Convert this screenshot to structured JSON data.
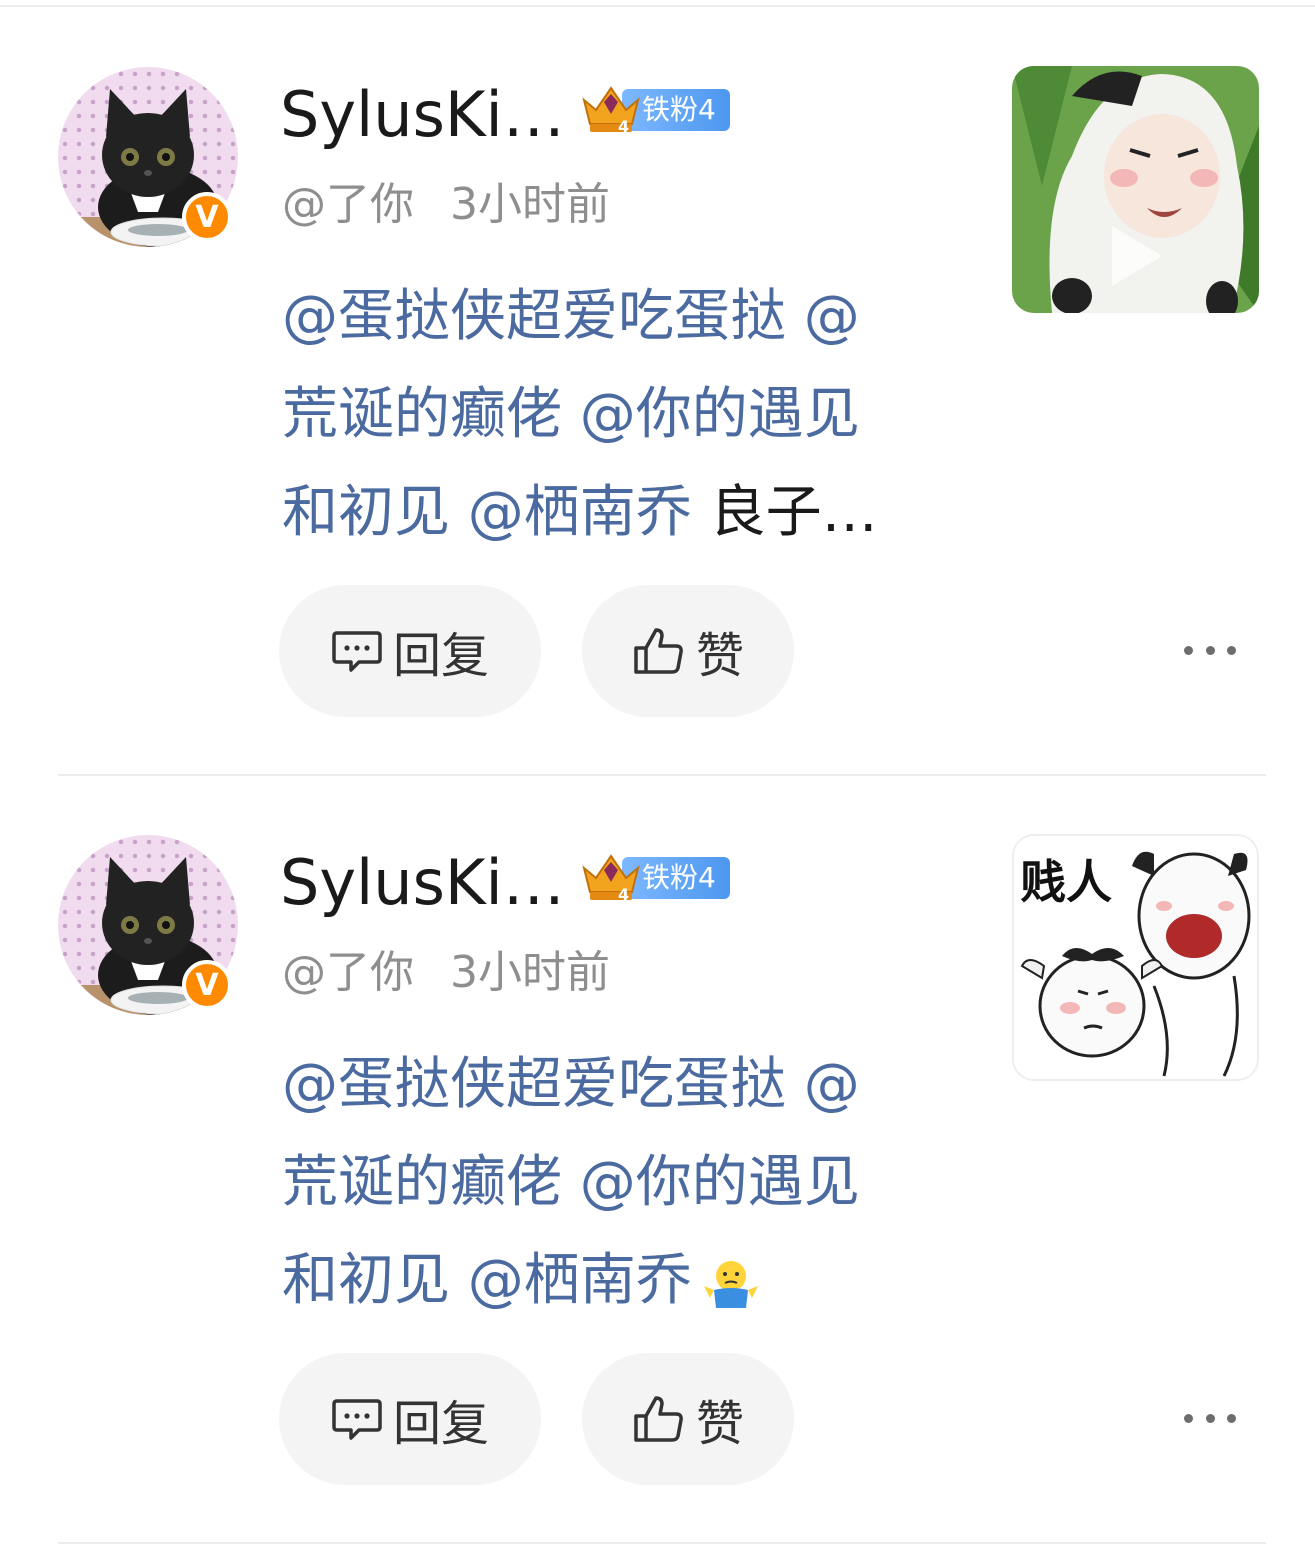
{
  "comments": [
    {
      "username": "SylusKi…",
      "fan_badge": {
        "label": "铁粉4",
        "level": "4"
      },
      "handle": "@了你",
      "time": "3小时前",
      "text_segments": [
        {
          "type": "mention",
          "text": "@蛋挞侠超爱吃蛋挞 @"
        },
        {
          "type": "mention",
          "text": "荒诞的癫佬 @你的遇见"
        },
        {
          "type": "mention",
          "text": "和初见 @栖南乔"
        },
        {
          "type": "plain",
          "text": " 良子…"
        }
      ],
      "reply_label": "回复",
      "like_label": "赞",
      "thumbnail": {
        "kind": "video",
        "icon": "play-icon"
      }
    },
    {
      "username": "SylusKi…",
      "fan_badge": {
        "label": "铁粉4",
        "level": "4"
      },
      "handle": "@了你",
      "time": "3小时前",
      "text_segments": [
        {
          "type": "mention",
          "text": "@蛋挞侠超爱吃蛋挞 @"
        },
        {
          "type": "mention",
          "text": "荒诞的癫佬 @你的遇见"
        },
        {
          "type": "mention",
          "text": "和初见 @栖南乔"
        }
      ],
      "emoji": "shrug-emoji",
      "reply_label": "回复",
      "like_label": "赞",
      "thumbnail": {
        "kind": "image",
        "caption": "贱人"
      }
    }
  ],
  "colors": {
    "mention": "#4a6aa0",
    "badge_v": "#ff8a00",
    "fan_pill": "#5ca3f5"
  }
}
